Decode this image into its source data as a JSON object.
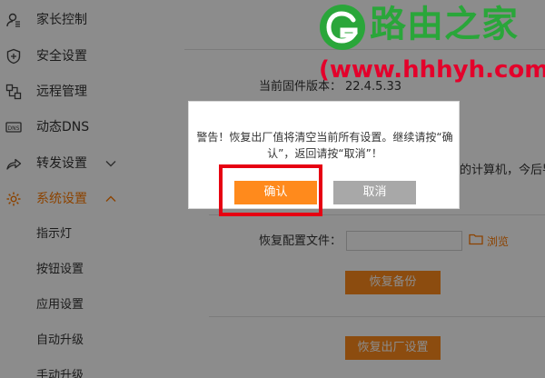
{
  "sidebar": {
    "items": [
      {
        "label": "家长控制",
        "icon": "parental-control-icon"
      },
      {
        "label": "安全设置",
        "icon": "shield-icon"
      },
      {
        "label": "远程管理",
        "icon": "remote-management-icon"
      },
      {
        "label": "动态DNS",
        "icon": "dns-icon"
      },
      {
        "label": "转发设置",
        "icon": "forward-icon"
      },
      {
        "label": "系统设置",
        "icon": "gear-icon"
      }
    ],
    "sub_items": [
      {
        "label": "指示灯"
      },
      {
        "label": "按钮设置"
      },
      {
        "label": "应用设置"
      },
      {
        "label": "自动升级"
      },
      {
        "label": "手动升级"
      }
    ]
  },
  "main": {
    "firmware_label": "当前固件版本：",
    "firmware_value": "22.4.5.33",
    "backup_note": "的计算机，今后导",
    "restore_config_label": "恢复配置文件：",
    "browse_label": "浏览",
    "restore_backup_button": "恢复备份",
    "factory_reset_button": "恢复出厂设置"
  },
  "dialog": {
    "message": "警告！恢复出厂值将清空当前所有设置。继续请按“确认”，返回请按“取消”！",
    "confirm_label": "确认",
    "cancel_label": "取消"
  },
  "watermark": {
    "brand": "路由之家",
    "url": "(www.hhhyh.com)"
  },
  "colors": {
    "accent": "#ff8a1c",
    "highlight": "#e60012",
    "watermark_green": "#2aa63a",
    "watermark_red": "#e4002b"
  }
}
